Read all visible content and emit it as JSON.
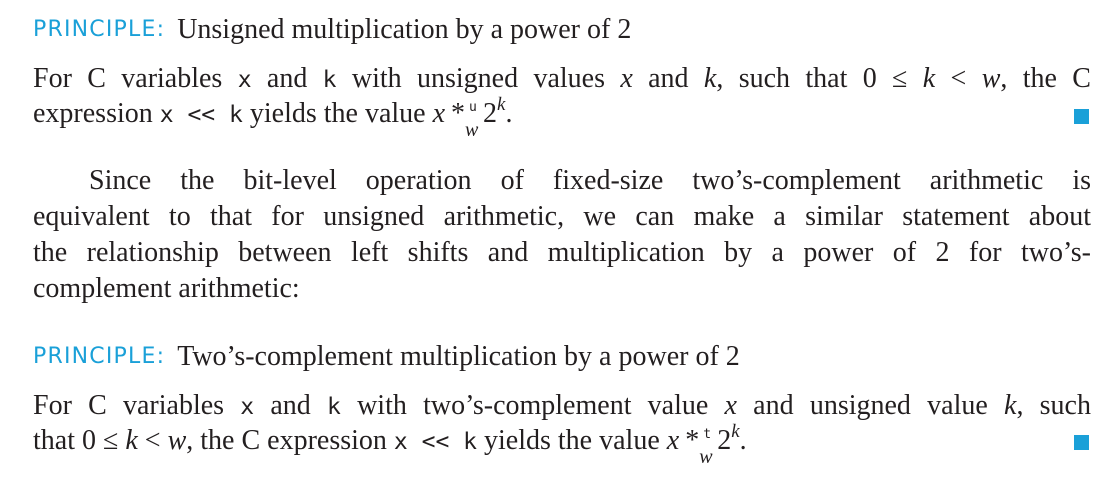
{
  "principle1": {
    "label": "PRINCIPLE:",
    "title": "Unsigned multiplication by a power of 2",
    "line1": {
      "a": "For C variables ",
      "x_code": "x",
      "b": " and ",
      "k_code": "k",
      "c": " with unsigned values ",
      "x_var": "x",
      "d": " and ",
      "k_var": "k",
      "e": ", such that 0 ≤ ",
      "k_var2": "k",
      "f": " < ",
      "w_var": "w",
      "g": ", the C"
    },
    "line2": {
      "a": "expression ",
      "code": "x << k",
      "b": " yields the value ",
      "x_var": "x",
      "op": "*",
      "op_sup": "u",
      "op_sub": "w",
      "base": "2",
      "exp": "k",
      "end": "."
    }
  },
  "paragraph": {
    "lines": [
      "Since the bit-level operation of fixed-size two’s-complement arithmetic is",
      "equivalent to that for unsigned arithmetic, we can make a similar statement about",
      "the relationship between left shifts and multiplication by a power of 2 for two’s-",
      "complement arithmetic:"
    ]
  },
  "principle2": {
    "label": "PRINCIPLE:",
    "title": "Two’s-complement multiplication by a power of 2",
    "line1": {
      "a": "For C variables ",
      "x_code": "x",
      "b": " and ",
      "k_code": "k",
      "c": " with two’s-complement value ",
      "x_var": "x",
      "d": " and unsigned value ",
      "k_var": "k",
      "e": ", such"
    },
    "line2": {
      "a": "that 0 ≤ ",
      "k_var": "k",
      "b": " < ",
      "w_var": "w",
      "c": ", the C expression ",
      "code": "x << k",
      "d": " yields the value ",
      "x_var": "x",
      "op": "*",
      "op_sup": "t",
      "op_sub": "w",
      "base": "2",
      "exp": "k",
      "end": "."
    }
  },
  "colors": {
    "accent": "#1aa0d8",
    "text": "#231f20"
  },
  "icons": {
    "end_marker": "end-of-principle-square"
  }
}
